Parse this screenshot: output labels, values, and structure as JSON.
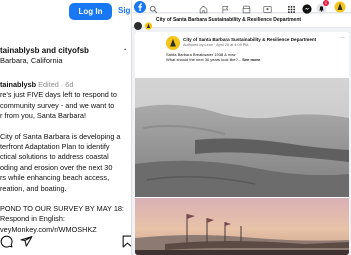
{
  "instagram": {
    "login_label": "Log In",
    "signup_label": "Sig",
    "post_accounts": "tainablysb and cityofsb",
    "post_location": "Barbara, California",
    "more_label": "·",
    "caption": {
      "username": "tainablysb",
      "meta": "Edited · 6d",
      "lines": [
        "re's just FIVE days left to respond to",
        "community survey - and we want to",
        "r from you, Santa Barbara!"
      ],
      "paragraph2": [
        "City of Santa Barbara is developing a",
        "terfront Adaptation Plan to identify",
        "ctical solutions to address coastal",
        "oding and erosion over the next 30",
        "rs while enhancing beach access,",
        "reation, and boating."
      ],
      "paragraph3": [
        "POND TO OUR SURVEY BY MAY 18:",
        "Respond in English:",
        "veyMonkey.com/r/WMOSHKZ"
      ]
    },
    "icons": [
      "comment-icon",
      "share-icon",
      "bookmark-icon"
    ]
  },
  "facebook": {
    "nav_icons": [
      "facebook-logo-icon",
      "search-icon",
      "home-icon",
      "flag-icon",
      "marketplace-icon",
      "groups-icon",
      "menu-grid-icon",
      "messenger-icon",
      "notifications-icon",
      "profile-avatar-icon"
    ],
    "notification_count": "1",
    "page_title": "City of Santa Barbara Sustainability & Resilience Department",
    "post": {
      "page_name": "City of Santa Barbara Sustainability & Resilience Department",
      "meta": "Authored by Leon · April 28 at 4:09 PM ·",
      "text_line1": "Santa Barbara Breakwater 1938 & now",
      "text_line2": "What should the next 30 years look like?...",
      "see_more": "See more",
      "more_label": "···"
    },
    "colors": {
      "brand_blue": "#1877f2",
      "notification_red": "#e41e3f",
      "page_icon_yellow": "#f5c518"
    }
  }
}
